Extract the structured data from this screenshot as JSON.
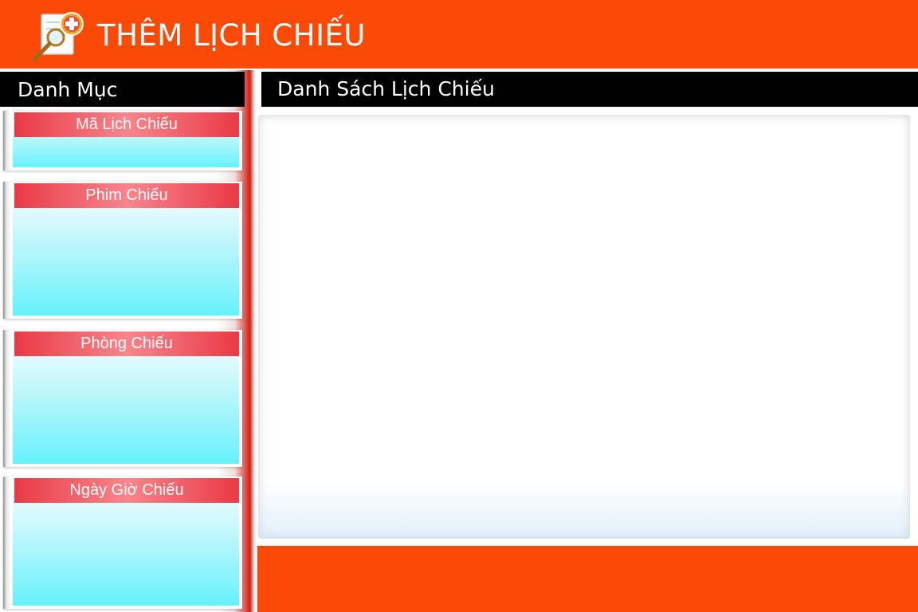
{
  "header": {
    "title": "THÊM LỊCH CHIẾU",
    "icon": "add-schedule-icon"
  },
  "sidebar": {
    "heading": "Danh Mục",
    "cards": [
      {
        "label": "Mã Lịch Chiếu"
      },
      {
        "label": "Phim Chiếu"
      },
      {
        "label": "Phòng Chiếu"
      },
      {
        "label": "Ngày Giờ Chiếu"
      }
    ]
  },
  "main": {
    "heading": "Danh Sách Lịch Chiếu"
  },
  "colors": {
    "accent": "#fb4a05",
    "heading_bg": "#000000",
    "card_title": "#e93a46",
    "card_body": "#66f2fc"
  }
}
